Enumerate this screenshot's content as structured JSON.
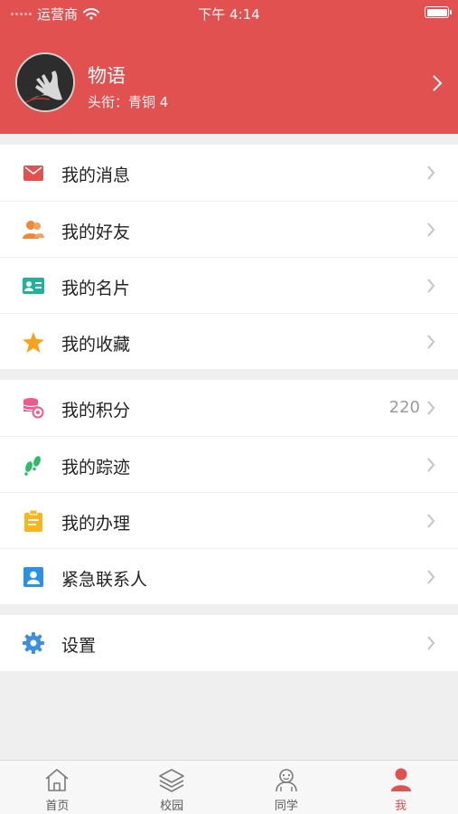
{
  "status_bar": {
    "carrier": "运营商",
    "time": "下午 4:14"
  },
  "profile": {
    "name": "物语",
    "title": "头衔：青铜 4"
  },
  "groups": [
    [
      {
        "label": "我的消息",
        "icon": "mail-icon"
      },
      {
        "label": "我的好友",
        "icon": "friends-icon"
      },
      {
        "label": "我的名片",
        "icon": "card-icon"
      },
      {
        "label": "我的收藏",
        "icon": "star-icon"
      }
    ],
    [
      {
        "label": "我的积分",
        "icon": "points-icon",
        "value": "220"
      },
      {
        "label": "我的踪迹",
        "icon": "footprint-icon"
      },
      {
        "label": "我的办理",
        "icon": "clipboard-icon"
      },
      {
        "label": "紧急联系人",
        "icon": "contact-icon"
      }
    ],
    [
      {
        "label": "设置",
        "icon": "gear-icon"
      }
    ]
  ],
  "tabbar": {
    "tabs": [
      {
        "label": "首页",
        "icon": "home-icon"
      },
      {
        "label": "校园",
        "icon": "layers-icon"
      },
      {
        "label": "同学",
        "icon": "classmates-icon"
      },
      {
        "label": "我",
        "icon": "person-icon"
      }
    ],
    "active_index": 3
  },
  "colors": {
    "brand": "#e05150",
    "mail": "#e05150",
    "friends": "#f0883a",
    "card": "#1fb39a",
    "star": "#f7a21b",
    "points": "#ec5b8e",
    "footprint": "#2bbd6a",
    "clipboard": "#f7b51e",
    "contact": "#2a92e6",
    "gear": "#3b8fe0"
  }
}
